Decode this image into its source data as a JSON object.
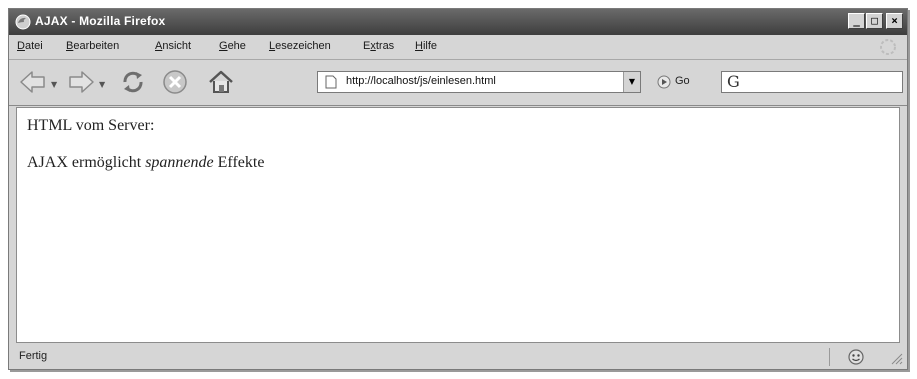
{
  "window": {
    "title": "AJAX - Mozilla Firefox",
    "controls": {
      "minimize": "_",
      "maximize": "□",
      "close": "×"
    }
  },
  "menu": {
    "items": [
      {
        "label": "Datei",
        "accel": "D",
        "rest": "atei"
      },
      {
        "label": "Bearbeiten",
        "accel": "B",
        "rest": "earbeiten"
      },
      {
        "label": "Ansicht",
        "accel": "A",
        "rest": "nsicht"
      },
      {
        "label": "Gehe",
        "accel": "G",
        "rest": "ehe"
      },
      {
        "label": "Lesezeichen",
        "accel": "L",
        "rest": "esezeichen"
      },
      {
        "label": "Extras",
        "pre": "E",
        "accel": "x",
        "rest": "tras"
      },
      {
        "label": "Hilfe",
        "accel": "H",
        "rest": "ilfe"
      }
    ]
  },
  "toolbar": {
    "back_icon": "back-arrow-icon",
    "forward_icon": "forward-arrow-icon",
    "reload_icon": "reload-icon",
    "stop_icon": "stop-icon",
    "home_icon": "home-icon",
    "url": "http://localhost/js/einlesen.html",
    "go_label": "Go",
    "search_engine_icon": "G"
  },
  "content": {
    "line1": "HTML vom Server:",
    "line2_before": "AJAX ermöglicht ",
    "line2_em": "spannende",
    "line2_after": " Effekte"
  },
  "status": {
    "text": "Fertig"
  },
  "colors": {
    "titlebar": "#4a4a4a",
    "chrome": "#d6d6d6",
    "content_bg": "#ffffff"
  }
}
